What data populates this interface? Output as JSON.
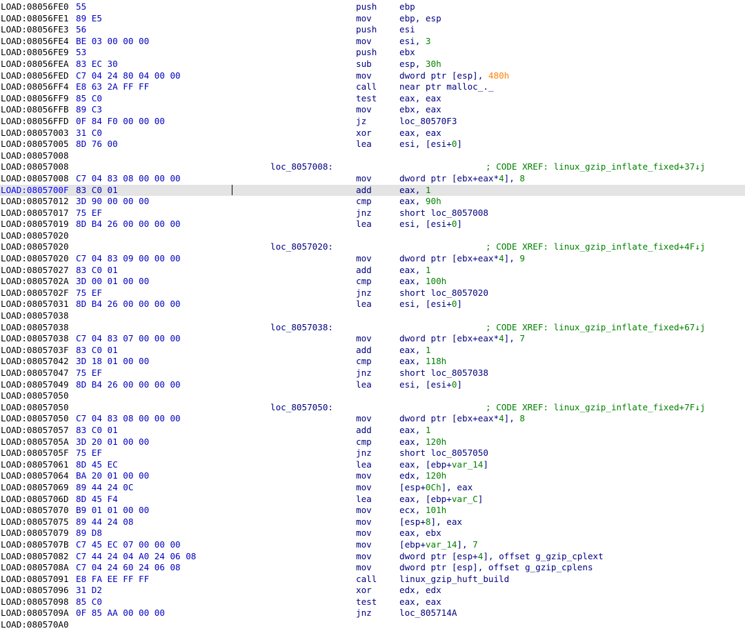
{
  "segment": "LOAD",
  "colors": {
    "address": "#000000",
    "address_selected": "#0000ff",
    "bytes": "#0000c0",
    "code": "#000080",
    "number": "#008000",
    "comment": "#008000",
    "highlight_number": "#ff8000",
    "selected_row_bg": "#e4e4e4"
  },
  "selected_row_index": 16,
  "rows": [
    {
      "addr": "LOAD:08056FE0",
      "bytes": "55",
      "mn": "push",
      "ops": [
        {
          "t": "ebp"
        }
      ]
    },
    {
      "addr": "LOAD:08056FE1",
      "bytes": "89 E5",
      "mn": "mov",
      "ops": [
        {
          "t": "ebp, esp"
        }
      ]
    },
    {
      "addr": "LOAD:08056FE3",
      "bytes": "56",
      "mn": "push",
      "ops": [
        {
          "t": "esi"
        }
      ]
    },
    {
      "addr": "LOAD:08056FE4",
      "bytes": "BE 03 00 00 00",
      "mn": "mov",
      "ops": [
        {
          "t": "esi, "
        },
        {
          "t": "3",
          "c": "num"
        }
      ]
    },
    {
      "addr": "LOAD:08056FE9",
      "bytes": "53",
      "mn": "push",
      "ops": [
        {
          "t": "ebx"
        }
      ]
    },
    {
      "addr": "LOAD:08056FEA",
      "bytes": "83 EC 30",
      "mn": "sub",
      "ops": [
        {
          "t": "esp, "
        },
        {
          "t": "30h",
          "c": "num"
        }
      ]
    },
    {
      "addr": "LOAD:08056FED",
      "bytes": "C7 04 24 80 04 00 00",
      "mn": "mov",
      "ops": [
        {
          "t": "dword ptr [esp], "
        },
        {
          "t": "480h",
          "c": "orange"
        }
      ]
    },
    {
      "addr": "LOAD:08056FF4",
      "bytes": "E8 63 2A FF FF",
      "mn": "call",
      "ops": [
        {
          "t": "near ptr malloc_._"
        }
      ]
    },
    {
      "addr": "LOAD:08056FF9",
      "bytes": "85 C0",
      "mn": "test",
      "ops": [
        {
          "t": "eax, eax"
        }
      ]
    },
    {
      "addr": "LOAD:08056FFB",
      "bytes": "89 C3",
      "mn": "mov",
      "ops": [
        {
          "t": "ebx, eax"
        }
      ]
    },
    {
      "addr": "LOAD:08056FFD",
      "bytes": "0F 84 F0 00 00 00",
      "mn": "jz",
      "ops": [
        {
          "t": "loc_80570F3"
        }
      ]
    },
    {
      "addr": "LOAD:08057003",
      "bytes": "31 C0",
      "mn": "xor",
      "ops": [
        {
          "t": "eax, eax"
        }
      ]
    },
    {
      "addr": "LOAD:08057005",
      "bytes": "8D 76 00",
      "mn": "lea",
      "ops": [
        {
          "t": "esi, [esi+"
        },
        {
          "t": "0",
          "c": "num"
        },
        {
          "t": "]"
        }
      ]
    },
    {
      "addr": "LOAD:08057008"
    },
    {
      "addr": "LOAD:08057008",
      "label": "loc_8057008:",
      "comment": "; CODE XREF: linux_gzip_inflate_fixed+37↓j"
    },
    {
      "addr": "LOAD:08057008",
      "bytes": "C7 04 83 08 00 00 00",
      "mn": "mov",
      "ops": [
        {
          "t": "dword ptr [ebx+eax*"
        },
        {
          "t": "4",
          "c": "num"
        },
        {
          "t": "], "
        },
        {
          "t": "8",
          "c": "num"
        }
      ]
    },
    {
      "addr": "LOAD:0805700F",
      "bytes": "83 C0 01",
      "mn": "add",
      "ops": [
        {
          "t": "eax, "
        },
        {
          "t": "1",
          "c": "num"
        }
      ]
    },
    {
      "addr": "LOAD:08057012",
      "bytes": "3D 90 00 00 00",
      "mn": "cmp",
      "ops": [
        {
          "t": "eax, "
        },
        {
          "t": "90h",
          "c": "num"
        }
      ]
    },
    {
      "addr": "LOAD:08057017",
      "bytes": "75 EF",
      "mn": "jnz",
      "ops": [
        {
          "t": "short loc_8057008"
        }
      ]
    },
    {
      "addr": "LOAD:08057019",
      "bytes": "8D B4 26 00 00 00 00",
      "mn": "lea",
      "ops": [
        {
          "t": "esi, [esi+"
        },
        {
          "t": "0",
          "c": "num"
        },
        {
          "t": "]"
        }
      ]
    },
    {
      "addr": "LOAD:08057020"
    },
    {
      "addr": "LOAD:08057020",
      "label": "loc_8057020:",
      "comment": "; CODE XREF: linux_gzip_inflate_fixed+4F↓j"
    },
    {
      "addr": "LOAD:08057020",
      "bytes": "C7 04 83 09 00 00 00",
      "mn": "mov",
      "ops": [
        {
          "t": "dword ptr [ebx+eax*"
        },
        {
          "t": "4",
          "c": "num"
        },
        {
          "t": "], "
        },
        {
          "t": "9",
          "c": "num"
        }
      ]
    },
    {
      "addr": "LOAD:08057027",
      "bytes": "83 C0 01",
      "mn": "add",
      "ops": [
        {
          "t": "eax, "
        },
        {
          "t": "1",
          "c": "num"
        }
      ]
    },
    {
      "addr": "LOAD:0805702A",
      "bytes": "3D 00 01 00 00",
      "mn": "cmp",
      "ops": [
        {
          "t": "eax, "
        },
        {
          "t": "100h",
          "c": "num"
        }
      ]
    },
    {
      "addr": "LOAD:0805702F",
      "bytes": "75 EF",
      "mn": "jnz",
      "ops": [
        {
          "t": "short loc_8057020"
        }
      ]
    },
    {
      "addr": "LOAD:08057031",
      "bytes": "8D B4 26 00 00 00 00",
      "mn": "lea",
      "ops": [
        {
          "t": "esi, [esi+"
        },
        {
          "t": "0",
          "c": "num"
        },
        {
          "t": "]"
        }
      ]
    },
    {
      "addr": "LOAD:08057038"
    },
    {
      "addr": "LOAD:08057038",
      "label": "loc_8057038:",
      "comment": "; CODE XREF: linux_gzip_inflate_fixed+67↓j"
    },
    {
      "addr": "LOAD:08057038",
      "bytes": "C7 04 83 07 00 00 00",
      "mn": "mov",
      "ops": [
        {
          "t": "dword ptr [ebx+eax*"
        },
        {
          "t": "4",
          "c": "num"
        },
        {
          "t": "], "
        },
        {
          "t": "7",
          "c": "num"
        }
      ]
    },
    {
      "addr": "LOAD:0805703F",
      "bytes": "83 C0 01",
      "mn": "add",
      "ops": [
        {
          "t": "eax, "
        },
        {
          "t": "1",
          "c": "num"
        }
      ]
    },
    {
      "addr": "LOAD:08057042",
      "bytes": "3D 18 01 00 00",
      "mn": "cmp",
      "ops": [
        {
          "t": "eax, "
        },
        {
          "t": "118h",
          "c": "num"
        }
      ]
    },
    {
      "addr": "LOAD:08057047",
      "bytes": "75 EF",
      "mn": "jnz",
      "ops": [
        {
          "t": "short loc_8057038"
        }
      ]
    },
    {
      "addr": "LOAD:08057049",
      "bytes": "8D B4 26 00 00 00 00",
      "mn": "lea",
      "ops": [
        {
          "t": "esi, [esi+"
        },
        {
          "t": "0",
          "c": "num"
        },
        {
          "t": "]"
        }
      ]
    },
    {
      "addr": "LOAD:08057050"
    },
    {
      "addr": "LOAD:08057050",
      "label": "loc_8057050:",
      "comment": "; CODE XREF: linux_gzip_inflate_fixed+7F↓j"
    },
    {
      "addr": "LOAD:08057050",
      "bytes": "C7 04 83 08 00 00 00",
      "mn": "mov",
      "ops": [
        {
          "t": "dword ptr [ebx+eax*"
        },
        {
          "t": "4",
          "c": "num"
        },
        {
          "t": "], "
        },
        {
          "t": "8",
          "c": "num"
        }
      ]
    },
    {
      "addr": "LOAD:08057057",
      "bytes": "83 C0 01",
      "mn": "add",
      "ops": [
        {
          "t": "eax, "
        },
        {
          "t": "1",
          "c": "num"
        }
      ]
    },
    {
      "addr": "LOAD:0805705A",
      "bytes": "3D 20 01 00 00",
      "mn": "cmp",
      "ops": [
        {
          "t": "eax, "
        },
        {
          "t": "120h",
          "c": "num"
        }
      ]
    },
    {
      "addr": "LOAD:0805705F",
      "bytes": "75 EF",
      "mn": "jnz",
      "ops": [
        {
          "t": "short loc_8057050"
        }
      ]
    },
    {
      "addr": "LOAD:08057061",
      "bytes": "8D 45 EC",
      "mn": "lea",
      "ops": [
        {
          "t": "eax, [ebp+"
        },
        {
          "t": "var_14",
          "c": "num"
        },
        {
          "t": "]"
        }
      ]
    },
    {
      "addr": "LOAD:08057064",
      "bytes": "BA 20 01 00 00",
      "mn": "mov",
      "ops": [
        {
          "t": "edx, "
        },
        {
          "t": "120h",
          "c": "num"
        }
      ]
    },
    {
      "addr": "LOAD:08057069",
      "bytes": "89 44 24 0C",
      "mn": "mov",
      "ops": [
        {
          "t": "[esp+"
        },
        {
          "t": "0Ch",
          "c": "num"
        },
        {
          "t": "], eax"
        }
      ]
    },
    {
      "addr": "LOAD:0805706D",
      "bytes": "8D 45 F4",
      "mn": "lea",
      "ops": [
        {
          "t": "eax, [ebp+"
        },
        {
          "t": "var_C",
          "c": "num"
        },
        {
          "t": "]"
        }
      ]
    },
    {
      "addr": "LOAD:08057070",
      "bytes": "B9 01 01 00 00",
      "mn": "mov",
      "ops": [
        {
          "t": "ecx, "
        },
        {
          "t": "101h",
          "c": "num"
        }
      ]
    },
    {
      "addr": "LOAD:08057075",
      "bytes": "89 44 24 08",
      "mn": "mov",
      "ops": [
        {
          "t": "[esp+"
        },
        {
          "t": "8",
          "c": "num"
        },
        {
          "t": "], eax"
        }
      ]
    },
    {
      "addr": "LOAD:08057079",
      "bytes": "89 D8",
      "mn": "mov",
      "ops": [
        {
          "t": "eax, ebx"
        }
      ]
    },
    {
      "addr": "LOAD:0805707B",
      "bytes": "C7 45 EC 07 00 00 00",
      "mn": "mov",
      "ops": [
        {
          "t": "[ebp+"
        },
        {
          "t": "var_14",
          "c": "num"
        },
        {
          "t": "], "
        },
        {
          "t": "7",
          "c": "num"
        }
      ]
    },
    {
      "addr": "LOAD:08057082",
      "bytes": "C7 44 24 04 A0 24 06 08",
      "mn": "mov",
      "ops": [
        {
          "t": "dword ptr [esp+"
        },
        {
          "t": "4",
          "c": "num"
        },
        {
          "t": "], offset g_gzip_cplext"
        }
      ]
    },
    {
      "addr": "LOAD:0805708A",
      "bytes": "C7 04 24 60 24 06 08",
      "mn": "mov",
      "ops": [
        {
          "t": "dword ptr [esp], offset g_gzip_cplens"
        }
      ]
    },
    {
      "addr": "LOAD:08057091",
      "bytes": "E8 FA EE FF FF",
      "mn": "call",
      "ops": [
        {
          "t": "linux_gzip_huft_build"
        }
      ]
    },
    {
      "addr": "LOAD:08057096",
      "bytes": "31 D2",
      "mn": "xor",
      "ops": [
        {
          "t": "edx, edx"
        }
      ]
    },
    {
      "addr": "LOAD:08057098",
      "bytes": "85 C0",
      "mn": "test",
      "ops": [
        {
          "t": "eax, eax"
        }
      ]
    },
    {
      "addr": "LOAD:0805709A",
      "bytes": "0F 85 AA 00 00 00",
      "mn": "jnz",
      "ops": [
        {
          "t": "loc_805714A"
        }
      ]
    },
    {
      "addr": "LOAD:080570A0"
    }
  ]
}
